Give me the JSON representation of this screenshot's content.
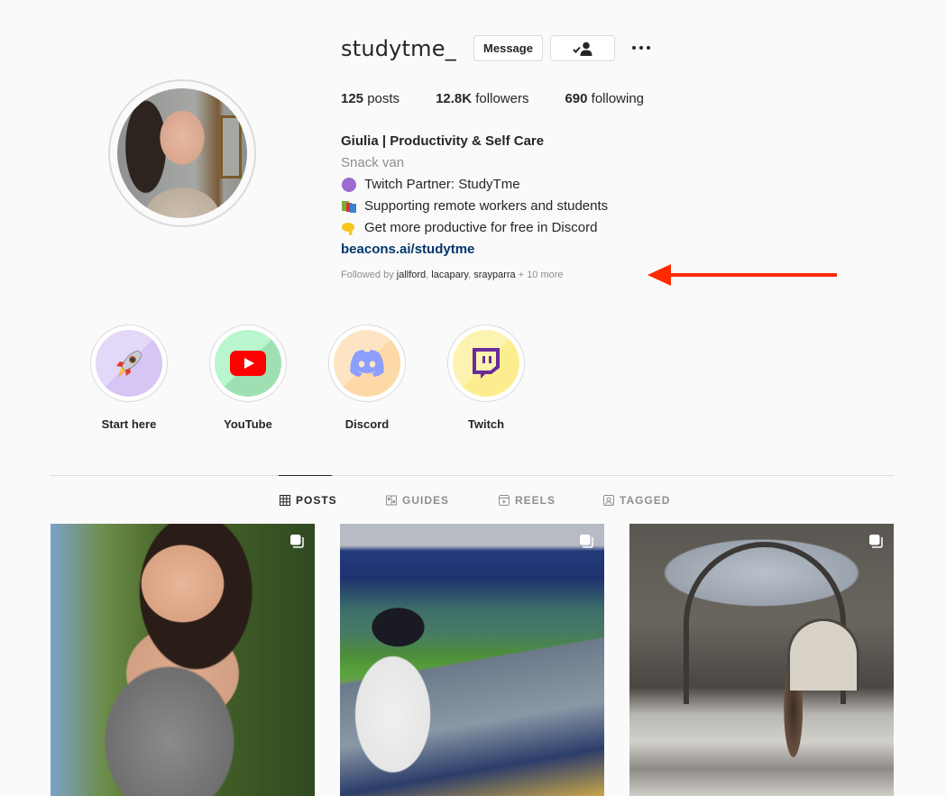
{
  "profile": {
    "username": "studytme_",
    "message_label": "Message",
    "follow_icon": "person-check-icon",
    "more_icon": "more-horizontal-icon"
  },
  "stats": {
    "posts_count": "125",
    "posts_label": "posts",
    "followers_count": "12.8K",
    "followers_label": "followers",
    "following_count": "690",
    "following_label": "following"
  },
  "bio": {
    "full_name": "Giulia | Productivity & Self Care",
    "category": "Snack van",
    "lines": [
      {
        "icon": "purple-circle-emoji",
        "text": "Twitch Partner: StudyTme"
      },
      {
        "icon": "books-emoji",
        "glyph": "📚",
        "text": "Supporting remote workers and students"
      },
      {
        "icon": "pointing-down-emoji",
        "glyph": "👇",
        "text": "Get more productive for free in Discord"
      }
    ],
    "link": "beacons.ai/studytme",
    "followed_by_prefix": "Followed by ",
    "followed_by_users": [
      "jallford",
      "lacapary",
      "srayparra"
    ],
    "followed_by_suffix": " + 10 more"
  },
  "annotation": {
    "arrow_color": "#ff2a00",
    "arrow_direction": "left"
  },
  "highlights": [
    {
      "label": "Start here",
      "icon": "rocket-icon",
      "colors": [
        "#e4d8f8",
        "#d5c6f5"
      ]
    },
    {
      "label": "YouTube",
      "icon": "youtube-icon",
      "colors": [
        "#b9f5cd",
        "#9ee0b2"
      ]
    },
    {
      "label": "Discord",
      "icon": "discord-icon",
      "colors": [
        "#fde5c3",
        "#fcd9a6"
      ]
    },
    {
      "label": "Twitch",
      "icon": "twitch-icon",
      "colors": [
        "#fdf3b0",
        "#fcee8f"
      ]
    }
  ],
  "tabs": [
    {
      "label": "POSTS",
      "icon": "grid-icon",
      "active": true
    },
    {
      "label": "GUIDES",
      "icon": "guides-icon",
      "active": false
    },
    {
      "label": "REELS",
      "icon": "reels-icon",
      "active": false
    },
    {
      "label": "TAGGED",
      "icon": "tagged-icon",
      "active": false
    }
  ],
  "posts": [
    {
      "description": "Woman in gingham top outdoors",
      "multi": true
    },
    {
      "description": "Woman at stadium watching football match",
      "multi": true
    },
    {
      "description": "Woman in ornate glass-roofed gallery",
      "multi": true
    }
  ],
  "colors": {
    "background": "#fafafa",
    "text": "#262626",
    "secondary_text": "#8e8e8e",
    "link": "#00376b",
    "border": "#dbdbdb"
  }
}
